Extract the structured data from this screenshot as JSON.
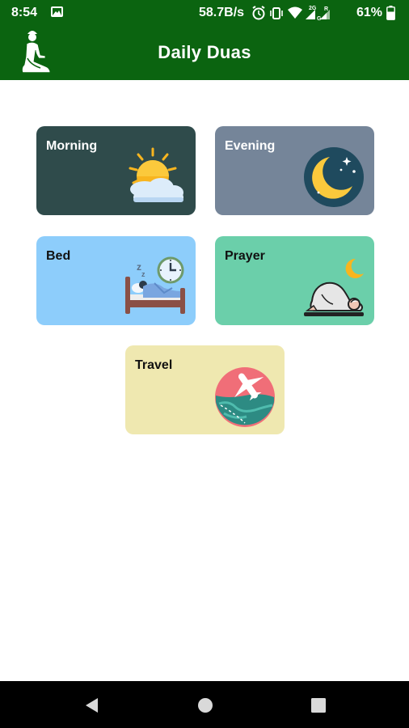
{
  "status_bar": {
    "time": "8:54",
    "net_speed": "58.7B/s",
    "battery_percent": "61%",
    "sim1_label": "2G",
    "sim2_label": "R",
    "g_label": "G"
  },
  "app_bar": {
    "title": "Daily Duas",
    "logo_icon": "praying-man-icon",
    "background": "#0b6410"
  },
  "cards": [
    {
      "label": "Morning",
      "icon": "sun-cloud-icon",
      "color": "#2f4b4b"
    },
    {
      "label": "Evening",
      "icon": "crescent-moon-icon",
      "color": "#758599"
    },
    {
      "label": "Bed",
      "icon": "sleeping-bed-icon",
      "color": "#8dcdfb"
    },
    {
      "label": "Prayer",
      "icon": "prostrating-man-icon",
      "color": "#6bcfaa"
    },
    {
      "label": "Travel",
      "icon": "airplane-globe-icon",
      "color": "#efe8b0"
    }
  ],
  "nav_bar": {
    "back_icon": "back-triangle-icon",
    "home_icon": "home-circle-icon",
    "recents_icon": "recents-square-icon"
  }
}
